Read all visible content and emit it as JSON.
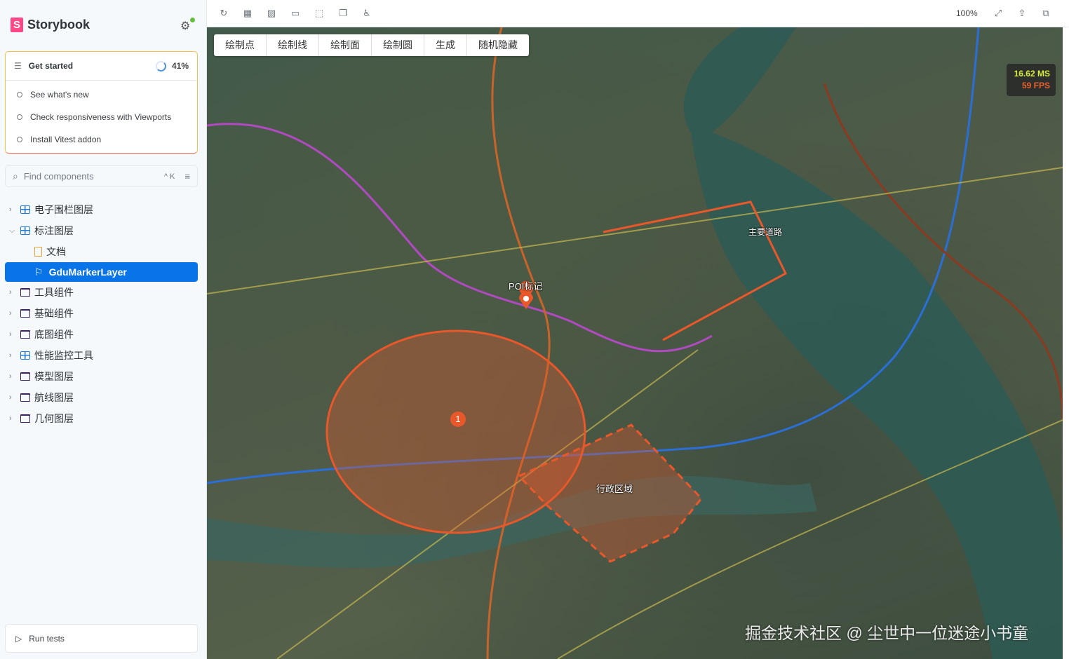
{
  "sidebar": {
    "brand": "Storybook",
    "checklist": {
      "title": "Get started",
      "progress": "41%",
      "items": [
        "See what's new",
        "Check responsiveness with Viewports",
        "Install Vitest addon"
      ]
    },
    "search": {
      "placeholder": "Find components",
      "shortcut": "^ K"
    },
    "tree": [
      {
        "label": "电子围栏图层",
        "icon": "component",
        "expanded": false
      },
      {
        "label": "标注图层",
        "icon": "component",
        "expanded": true
      },
      {
        "label": "文档",
        "icon": "document",
        "child": true
      },
      {
        "label": "GduMarkerLayer",
        "icon": "bookmark",
        "child": true,
        "selected": true
      },
      {
        "label": "工具组件",
        "icon": "folder"
      },
      {
        "label": "基础组件",
        "icon": "folder"
      },
      {
        "label": "底图组件",
        "icon": "folder"
      },
      {
        "label": "性能监控工具",
        "icon": "component"
      },
      {
        "label": "模型图层",
        "icon": "folder"
      },
      {
        "label": "航线图层",
        "icon": "folder"
      },
      {
        "label": "几何图层",
        "icon": "folder"
      }
    ],
    "run_tests": "Run tests"
  },
  "toolbar": {
    "zoom": "100%"
  },
  "map": {
    "buttons": [
      "绘制点",
      "绘制线",
      "绘制面",
      "绘制圆",
      "生成",
      "随机隐藏"
    ],
    "stats": {
      "ms": "16.62 MS",
      "fps": "59 FPS"
    },
    "labels": {
      "poi": "POI标记",
      "road": "主要道路",
      "region": "行政区域",
      "cluster": "1"
    },
    "watermark": "掘金技术社区 @ 尘世中一位迷途小书童",
    "colors": {
      "overlay": "#e8582a",
      "selected": "#0874e8"
    }
  }
}
